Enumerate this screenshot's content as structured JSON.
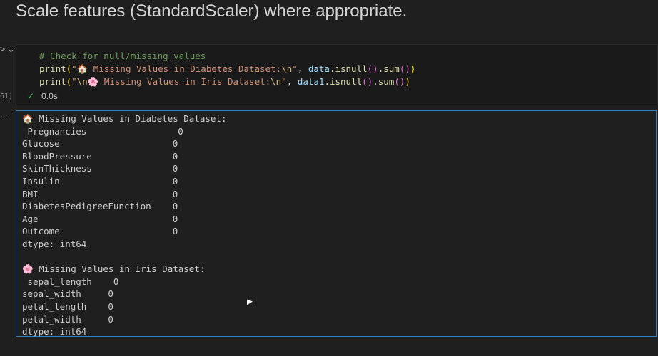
{
  "markdown": {
    "title": "Scale features (StandardScaler) where appropriate."
  },
  "cell": {
    "execution_count": "61]",
    "code": {
      "comment": "# Check for null/missing values",
      "line1_fn": "print",
      "line1_str": "\"🏠 Missing Values in Diabetes Dataset:",
      "line1_esc": "\\n",
      "line1_var": "data",
      "line1_rest": ".isnull().sum()",
      "line2_fn": "print",
      "line2_esc1": "\\n",
      "line2_str": "🌸 Missing Values in Iris Dataset:",
      "line2_esc": "\\n",
      "line2_var": "data1",
      "line2_rest": ".isnull().sum()"
    },
    "status": {
      "time": "0.0s"
    }
  },
  "output": {
    "text": "🏠 Missing Values in Diabetes Dataset:\n Pregnancies                 0\nGlucose                     0\nBloodPressure               0\nSkinThickness               0\nInsulin                     0\nBMI                         0\nDiabetesPedigreeFunction    0\nAge                         0\nOutcome                     0\ndtype: int64\n\n🌸 Missing Values in Iris Dataset:\n sepal_length    0\nsepal_width     0\npetal_length    0\npetal_width     0\ndtype: int64"
  }
}
